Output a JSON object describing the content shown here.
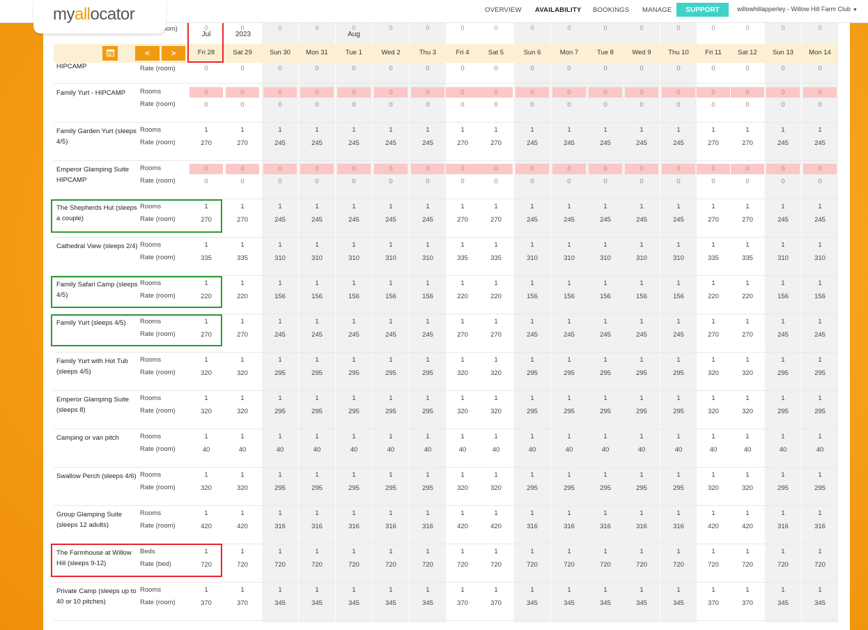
{
  "app": {
    "logo_text_a": "my",
    "logo_text_b": "all",
    "logo_text_c": "ocator"
  },
  "nav": {
    "overview": "OVERVIEW",
    "availability": "AVAILABILITY",
    "bookings": "BOOKINGS",
    "manage": "MANAGE",
    "support": "SUPPORT",
    "user": "willowhillapperley - Willow Hill Farm Club"
  },
  "toolbar": {
    "prev": "<",
    "next": ">"
  },
  "months": {
    "jul": "Jul",
    "year": "2023",
    "aug": "Aug",
    "rate_room_label": "(room)"
  },
  "dates": [
    "Fri 28",
    "Sat 29",
    "Sun 30",
    "Mon 31",
    "Tue 1",
    "Wed 2",
    "Thu 3",
    "Fri 4",
    "Sat 5",
    "Sun 6",
    "Mon 7",
    "Tue 8",
    "Wed 9",
    "Thu 10",
    "Fri 11",
    "Sat 12",
    "Sun 13",
    "Mon 14"
  ],
  "first_row": {
    "name": "HIPCAMP",
    "label": "Rate (room)"
  },
  "rows": [
    {
      "name": "Family Yurt - HIPCAMP",
      "l1": "Rooms",
      "l2": "Rate (room)",
      "v1": [
        "0",
        "0",
        "0",
        "0",
        "0",
        "0",
        "0",
        "0",
        "0",
        "0",
        "0",
        "0",
        "0",
        "0",
        "0",
        "0",
        "0",
        "0"
      ],
      "v2": [
        "0",
        "0",
        "0",
        "0",
        "0",
        "0",
        "0",
        "0",
        "0",
        "0",
        "0",
        "0",
        "0",
        "0",
        "0",
        "0",
        "0",
        "0"
      ],
      "unavailable": true
    },
    {
      "name": "Family Garden Yurt (sleeps 4/5)",
      "l1": "Rooms",
      "l2": "Rate (room)",
      "v1": [
        "1",
        "1",
        "1",
        "1",
        "1",
        "1",
        "1",
        "1",
        "1",
        "1",
        "1",
        "1",
        "1",
        "1",
        "1",
        "1",
        "1",
        "1"
      ],
      "v2": [
        "270",
        "270",
        "245",
        "245",
        "245",
        "245",
        "245",
        "270",
        "270",
        "245",
        "245",
        "245",
        "245",
        "245",
        "270",
        "270",
        "245",
        "245"
      ]
    },
    {
      "name": "Emperor Glamping Suite HIPCAMP",
      "l1": "Rooms",
      "l2": "Rate (room)",
      "v1": [
        "0",
        "0",
        "0",
        "0",
        "0",
        "0",
        "0",
        "0",
        "0",
        "0",
        "0",
        "0",
        "0",
        "0",
        "0",
        "0",
        "0",
        "0"
      ],
      "v2": [
        "0",
        "0",
        "0",
        "0",
        "0",
        "0",
        "0",
        "0",
        "0",
        "0",
        "0",
        "0",
        "0",
        "0",
        "0",
        "0",
        "0",
        "0"
      ],
      "unavailable": true
    },
    {
      "name": "The Shepherds Hut (sleeps a couple)",
      "l1": "Rooms",
      "l2": "Rate (room)",
      "v1": [
        "1",
        "1",
        "1",
        "1",
        "1",
        "1",
        "1",
        "1",
        "1",
        "1",
        "1",
        "1",
        "1",
        "1",
        "1",
        "1",
        "1",
        "1"
      ],
      "v2": [
        "270",
        "270",
        "245",
        "245",
        "245",
        "245",
        "245",
        "270",
        "270",
        "245",
        "245",
        "245",
        "245",
        "245",
        "270",
        "270",
        "245",
        "245"
      ]
    },
    {
      "name": "Cathedral View (sleeps 2/4)",
      "l1": "Rooms",
      "l2": "Rate (room)",
      "v1": [
        "1",
        "1",
        "1",
        "1",
        "1",
        "1",
        "1",
        "1",
        "1",
        "1",
        "1",
        "1",
        "1",
        "1",
        "1",
        "1",
        "1",
        "1"
      ],
      "v2": [
        "335",
        "335",
        "310",
        "310",
        "310",
        "310",
        "310",
        "335",
        "335",
        "310",
        "310",
        "310",
        "310",
        "310",
        "335",
        "335",
        "310",
        "310"
      ]
    },
    {
      "name": "Family Safari Camp (sleeps 4/5)",
      "l1": "Rooms",
      "l2": "Rate (room)",
      "v1": [
        "1",
        "1",
        "1",
        "1",
        "1",
        "1",
        "1",
        "1",
        "1",
        "1",
        "1",
        "1",
        "1",
        "1",
        "1",
        "1",
        "1",
        "1"
      ],
      "v2": [
        "220",
        "220",
        "156",
        "156",
        "156",
        "156",
        "156",
        "220",
        "220",
        "156",
        "156",
        "156",
        "156",
        "156",
        "220",
        "220",
        "156",
        "156"
      ]
    },
    {
      "name": "Family Yurt (sleeps 4/5)",
      "l1": "Rooms",
      "l2": "Rate (room)",
      "v1": [
        "1",
        "1",
        "1",
        "1",
        "1",
        "1",
        "1",
        "1",
        "1",
        "1",
        "1",
        "1",
        "1",
        "1",
        "1",
        "1",
        "1",
        "1"
      ],
      "v2": [
        "270",
        "270",
        "245",
        "245",
        "245",
        "245",
        "245",
        "270",
        "270",
        "245",
        "245",
        "245",
        "245",
        "245",
        "270",
        "270",
        "245",
        "245"
      ]
    },
    {
      "name": "Family Yurt with Hot Tub (sleeps 4/5)",
      "l1": "Rooms",
      "l2": "Rate (room)",
      "v1": [
        "1",
        "1",
        "1",
        "1",
        "1",
        "1",
        "1",
        "1",
        "1",
        "1",
        "1",
        "1",
        "1",
        "1",
        "1",
        "1",
        "1",
        "1"
      ],
      "v2": [
        "320",
        "320",
        "295",
        "295",
        "295",
        "295",
        "295",
        "320",
        "320",
        "295",
        "295",
        "295",
        "295",
        "295",
        "320",
        "320",
        "295",
        "295"
      ]
    },
    {
      "name": "Emperor Glamping Suite (sleeps 8)",
      "l1": "Rooms",
      "l2": "Rate (room)",
      "v1": [
        "1",
        "1",
        "1",
        "1",
        "1",
        "1",
        "1",
        "1",
        "1",
        "1",
        "1",
        "1",
        "1",
        "1",
        "1",
        "1",
        "1",
        "1"
      ],
      "v2": [
        "320",
        "320",
        "295",
        "295",
        "295",
        "295",
        "295",
        "320",
        "320",
        "295",
        "295",
        "295",
        "295",
        "295",
        "320",
        "320",
        "295",
        "295"
      ]
    },
    {
      "name": "Camping or van pitch",
      "l1": "Rooms",
      "l2": "Rate (room)",
      "v1": [
        "1",
        "1",
        "1",
        "1",
        "1",
        "1",
        "1",
        "1",
        "1",
        "1",
        "1",
        "1",
        "1",
        "1",
        "1",
        "1",
        "1",
        "1"
      ],
      "v2": [
        "40",
        "40",
        "40",
        "40",
        "40",
        "40",
        "40",
        "40",
        "40",
        "40",
        "40",
        "40",
        "40",
        "40",
        "40",
        "40",
        "40",
        "40"
      ]
    },
    {
      "name": "Swallow Perch (sleeps 4/6)",
      "l1": "Rooms",
      "l2": "Rate (room)",
      "v1": [
        "1",
        "1",
        "1",
        "1",
        "1",
        "1",
        "1",
        "1",
        "1",
        "1",
        "1",
        "1",
        "1",
        "1",
        "1",
        "1",
        "1",
        "1"
      ],
      "v2": [
        "320",
        "320",
        "295",
        "295",
        "295",
        "295",
        "295",
        "320",
        "320",
        "295",
        "295",
        "295",
        "295",
        "295",
        "320",
        "320",
        "295",
        "295"
      ]
    },
    {
      "name": "Group Glamping Suite (sleeps 12 adults)",
      "l1": "Rooms",
      "l2": "Rate (room)",
      "v1": [
        "1",
        "1",
        "1",
        "1",
        "1",
        "1",
        "1",
        "1",
        "1",
        "1",
        "1",
        "1",
        "1",
        "1",
        "1",
        "1",
        "1",
        "1"
      ],
      "v2": [
        "420",
        "420",
        "316",
        "316",
        "316",
        "316",
        "316",
        "420",
        "420",
        "316",
        "316",
        "316",
        "316",
        "316",
        "420",
        "420",
        "316",
        "316"
      ]
    },
    {
      "name": "The Farmhouse at Willow Hill (sleeps 9-12)",
      "l1": "Beds",
      "l2": "Rate (bed)",
      "v1": [
        "1",
        "1",
        "1",
        "1",
        "1",
        "1",
        "1",
        "1",
        "1",
        "1",
        "1",
        "1",
        "1",
        "1",
        "1",
        "1",
        "1",
        "1"
      ],
      "v2": [
        "720",
        "720",
        "720",
        "720",
        "720",
        "720",
        "720",
        "720",
        "720",
        "720",
        "720",
        "720",
        "720",
        "720",
        "720",
        "720",
        "720",
        "720"
      ]
    },
    {
      "name": "Private Camp (sleeps up to 40 or 10 pitches)",
      "l1": "Rooms",
      "l2": "Rate (room)",
      "v1": [
        "1",
        "1",
        "1",
        "1",
        "1",
        "1",
        "1",
        "1",
        "1",
        "1",
        "1",
        "1",
        "1",
        "1",
        "1",
        "1",
        "1",
        "1"
      ],
      "v2": [
        "370",
        "370",
        "345",
        "345",
        "345",
        "345",
        "345",
        "370",
        "370",
        "345",
        "345",
        "345",
        "345",
        "345",
        "370",
        "370",
        "345",
        "345"
      ]
    }
  ]
}
